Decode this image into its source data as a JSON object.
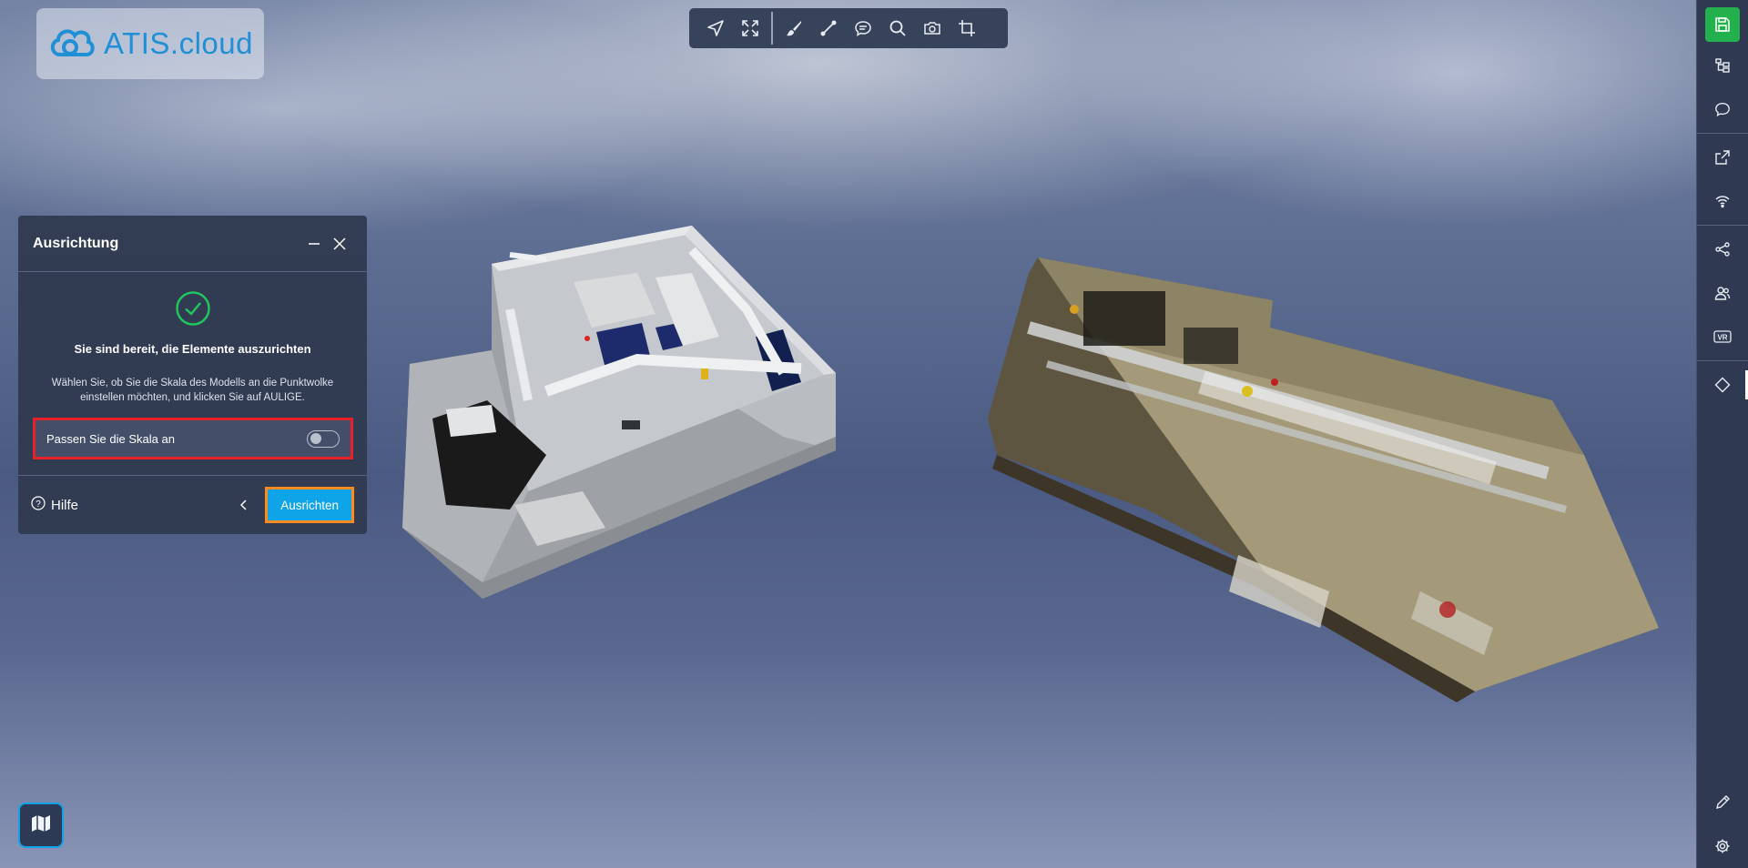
{
  "app": {
    "logo_text": "ATIS.cloud",
    "logo_icon": "cloud-logo-icon",
    "accent_color": "#0fa4e8",
    "save_color": "#22b14c"
  },
  "toolbar": {
    "tools": [
      {
        "name": "navigate",
        "icon": "navigate-arrow-icon"
      },
      {
        "name": "fit-view",
        "icon": "expand-icon"
      },
      {
        "name": "paint",
        "icon": "brush-icon"
      },
      {
        "name": "measure",
        "icon": "measure-line-icon"
      },
      {
        "name": "comment",
        "icon": "comment-icon"
      },
      {
        "name": "search",
        "icon": "search-icon"
      },
      {
        "name": "screenshot",
        "icon": "camera-icon"
      },
      {
        "name": "crop",
        "icon": "crop-icon"
      }
    ]
  },
  "sidebar": {
    "items": [
      "save-icon",
      "hierarchy-icon",
      "comments-icon",
      "external-link-icon",
      "wifi-icon",
      "share-icon",
      "users-icon",
      "vr-icon",
      "diamond-icon",
      "pencil-icon",
      "settings-icon"
    ],
    "vr_label": "VR"
  },
  "dialog": {
    "title": "Ausrichtung",
    "heading": "Sie sind bereit, die Elemente auszurichten",
    "description": "Wählen Sie, ob Sie die Skala des Modells an die Punktwolke einstellen möchten, und klicken Sie auf AULIGE.",
    "scale_label": "Passen Sie die Skala an",
    "scale_toggle_on": false,
    "help_label": "Hilfe",
    "primary_label": "Ausrichten"
  }
}
